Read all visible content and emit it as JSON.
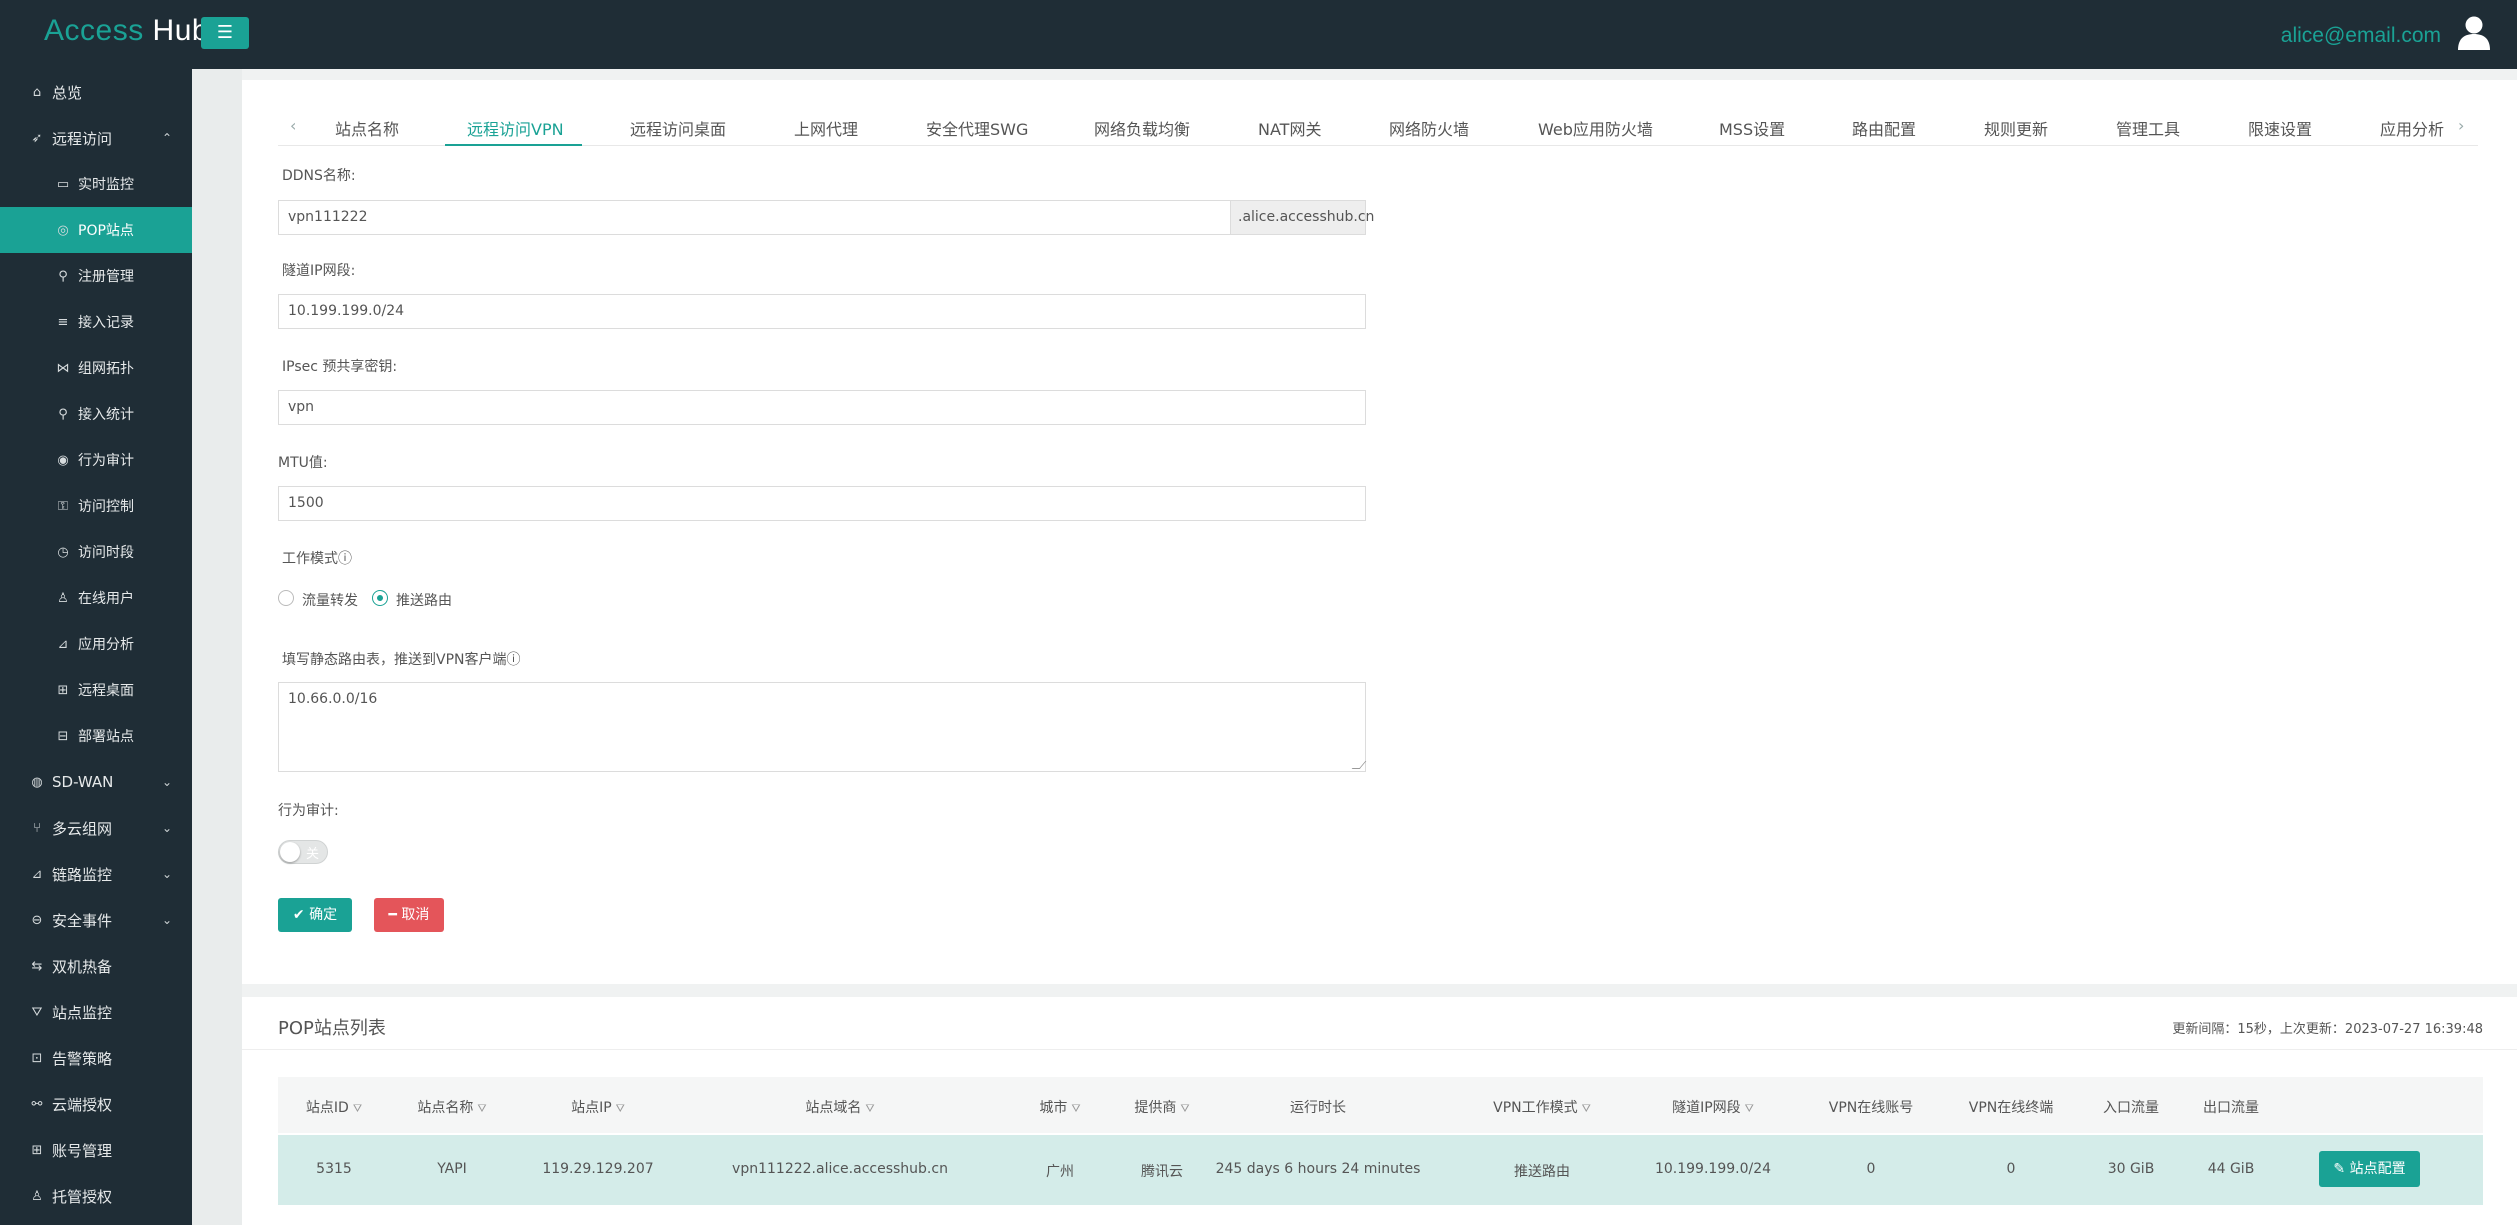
{
  "app": {
    "logo_part1": "Access",
    "logo_part2": "Hub",
    "menu_icon": "☰",
    "user_email": "alice@email.com"
  },
  "sidebar": {
    "items": [
      {
        "label": "总览",
        "icon": "home-icon"
      },
      {
        "label": "远程访问",
        "icon": "rocket-icon"
      },
      {
        "label": "实时监控",
        "icon": "monitor-icon"
      },
      {
        "label": "POP站点",
        "icon": "location-icon"
      },
      {
        "label": "注册管理",
        "icon": "user-plus-icon"
      },
      {
        "label": "接入记录",
        "icon": "list-icon"
      },
      {
        "label": "组网拓扑",
        "icon": "share-icon"
      },
      {
        "label": "接入统计",
        "icon": "search-icon"
      },
      {
        "label": "行为审计",
        "icon": "eye-icon"
      },
      {
        "label": "访问控制",
        "icon": "user-lock-icon"
      },
      {
        "label": "访问时段",
        "icon": "clock-icon"
      },
      {
        "label": "在线用户",
        "icon": "user-icon"
      },
      {
        "label": "应用分析",
        "icon": "chart-icon"
      },
      {
        "label": "远程桌面",
        "icon": "grid-icon"
      },
      {
        "label": "部署站点",
        "icon": "lock-icon"
      },
      {
        "label": "SD-WAN",
        "icon": "globe-icon"
      },
      {
        "label": "多云组网",
        "icon": "branch-icon"
      },
      {
        "label": "链路监控",
        "icon": "area-chart-icon"
      },
      {
        "label": "安全事件",
        "icon": "minus-circle-icon"
      },
      {
        "label": "双机热备",
        "icon": "exchange-icon"
      },
      {
        "label": "站点监控",
        "icon": "filter-icon"
      },
      {
        "label": "告警策略",
        "icon": "bell-icon"
      },
      {
        "label": "云端授权",
        "icon": "link-icon"
      },
      {
        "label": "账号管理",
        "icon": "grid-lock-icon"
      },
      {
        "label": "托管授权",
        "icon": "user-icon"
      }
    ]
  },
  "tabs": [
    "站点名称",
    "远程访问VPN",
    "远程访问桌面",
    "上网代理",
    "安全代理SWG",
    "网络负载均衡",
    "NAT网关",
    "网络防火墙",
    "Web应用防火墙",
    "MSS设置",
    "路由配置",
    "规则更新",
    "管理工具",
    "限速设置",
    "应用分析"
  ],
  "form": {
    "ddns_label": "DDNS名称:",
    "ddns_value": "vpn111222",
    "ddns_suffix": ".alice.accesshub.cn",
    "tunnel_label": "隧道IP网段:",
    "tunnel_value": "10.199.199.0/24",
    "psk_label": "IPsec 预共享密钥:",
    "psk_value": "vpn",
    "mtu_label": "MTU值:",
    "mtu_value": "1500",
    "mode_label": "工作模式",
    "mode_option1": "流量转发",
    "mode_option2": "推送路由",
    "mode_selected": "推送路由",
    "routes_label": "填写静态路由表，推送到VPN客户端",
    "routes_value": "10.66.0.0/16",
    "audit_label": "行为审计:",
    "audit_toggle": "关",
    "ok_label": "✔ 确定",
    "cancel_label": "━ 取消"
  },
  "list": {
    "title": "POP站点列表",
    "meta": "更新间隔：15秒，上次更新：2023-07-27 16:39:48",
    "columns": [
      "站点ID",
      "站点名称",
      "站点IP",
      "站点域名",
      "城市",
      "提供商",
      "运行时长",
      "VPN工作模式",
      "隧道IP网段",
      "VPN在线账号",
      "VPN在线终端",
      "入口流量",
      "出口流量"
    ],
    "rows": [
      [
        "5315",
        "YAPI",
        "119.29.129.207",
        "vpn111222.alice.accesshub.cn",
        "广州",
        "腾讯云",
        "245 days 6 hours 24 minutes",
        "推送路由",
        "10.199.199.0/24",
        "0",
        "0",
        "30 GiB",
        "44 GiB"
      ]
    ],
    "row_action": "✎ 站点配置"
  },
  "colors": {
    "accent": "#1aa295",
    "sidebar_bg": "#1f2d36",
    "danger": "#e4555a",
    "row_highlight": "#d4ece9"
  }
}
